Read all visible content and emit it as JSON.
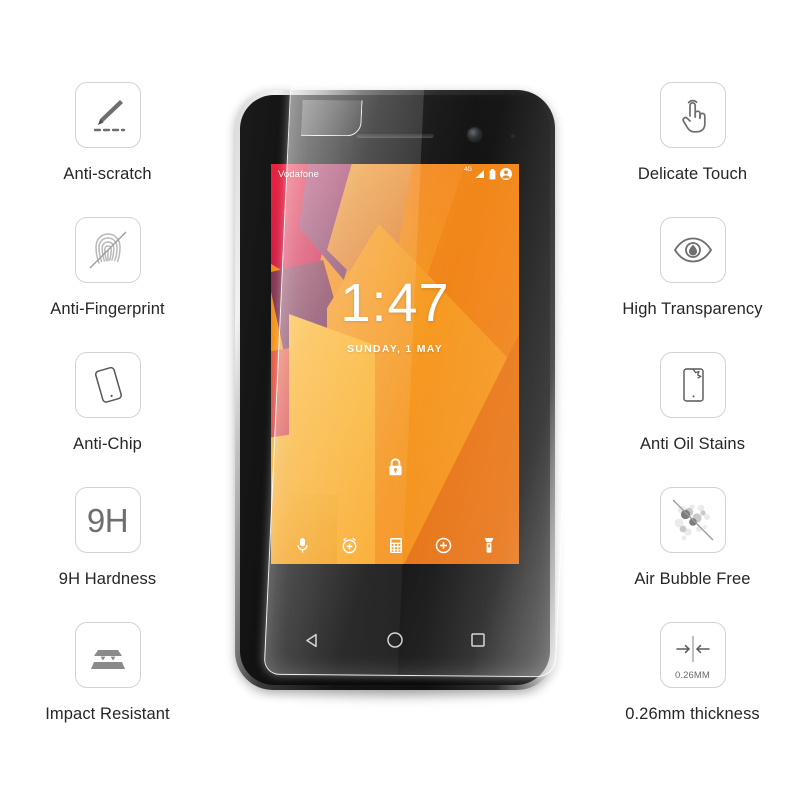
{
  "product": {
    "type": "tempered-glass-screen-protector",
    "background_color": "#ffffff",
    "label_color": "#262626"
  },
  "features_left": [
    {
      "label": "Anti-scratch",
      "icon": "knife-scratch-icon"
    },
    {
      "label": "Anti-Fingerprint",
      "icon": "fingerprint-crossed-icon"
    },
    {
      "label": "Anti-Chip",
      "icon": "tilted-phone-icon"
    },
    {
      "label": "9H Hardness",
      "icon": "9h-text-icon",
      "icon_text": "9H"
    },
    {
      "label": "Impact Resistant",
      "icon": "layered-impact-icon"
    }
  ],
  "features_right": [
    {
      "label": "Delicate Touch",
      "icon": "tap-hand-icon"
    },
    {
      "label": "High Transparency",
      "icon": "eye-icon"
    },
    {
      "label": "Anti Oil Stains",
      "icon": "phone-oil-stain-icon"
    },
    {
      "label": "Air Bubble Free",
      "icon": "bubbles-crossed-icon"
    },
    {
      "label": "0.26mm thickness",
      "icon": "thickness-arrows-icon",
      "icon_text": "0.26MM"
    }
  ],
  "phone": {
    "status_bar": {
      "carrier": "Vodafone",
      "network": "4G",
      "icons": [
        "signal-icon",
        "battery-icon",
        "account-icon"
      ]
    },
    "lockscreen": {
      "time": "1:47",
      "date": "SUNDAY, 1 MAY",
      "lock_icon": "padlock-icon"
    },
    "shortcuts": [
      {
        "name": "microphone-icon"
      },
      {
        "name": "alarm-add-icon"
      },
      {
        "name": "calculator-icon"
      },
      {
        "name": "add-circle-icon"
      },
      {
        "name": "flashlight-icon"
      }
    ],
    "nav_bar": [
      {
        "name": "back-icon"
      },
      {
        "name": "home-icon"
      },
      {
        "name": "recents-icon"
      }
    ]
  }
}
